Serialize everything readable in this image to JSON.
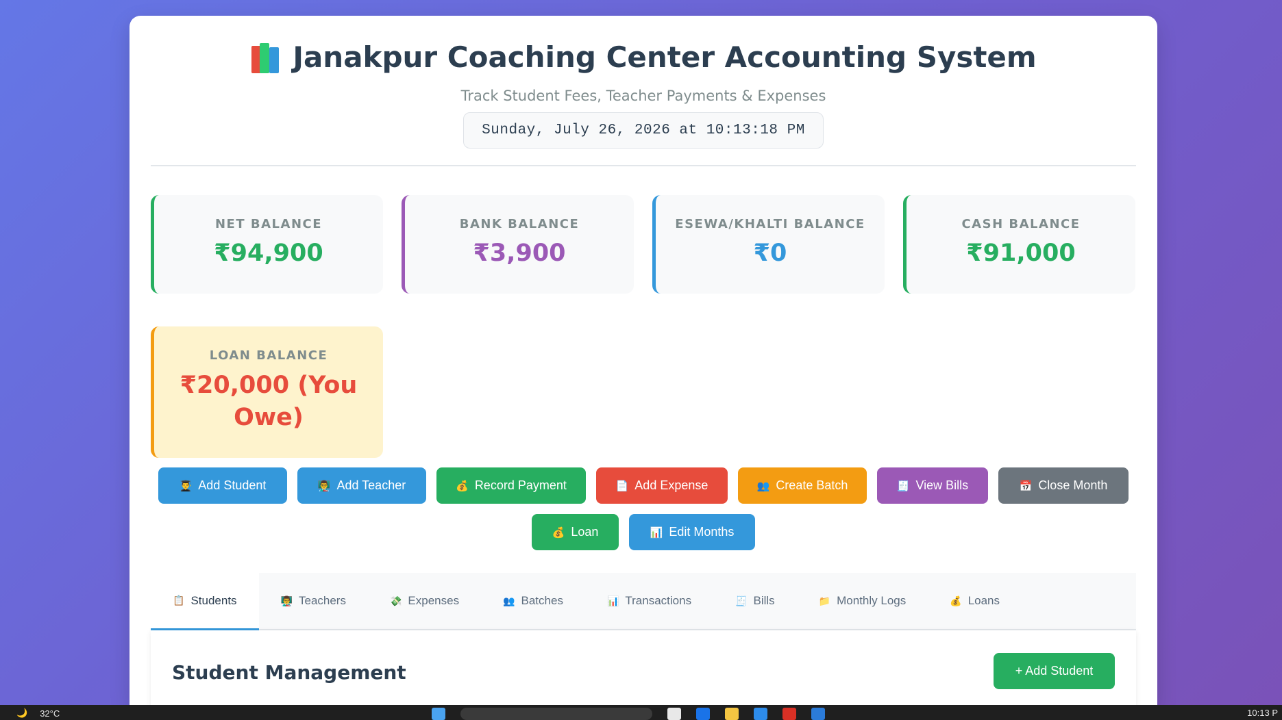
{
  "header": {
    "title": "Janakpur Coaching Center Accounting System",
    "subtitle": "Track Student Fees, Teacher Payments & Expenses",
    "datetime": "Sunday, July 26, 2026 at 10:13:18 PM"
  },
  "balances": [
    {
      "label": "NET BALANCE",
      "value": "₹94,900",
      "color": "#27ae60"
    },
    {
      "label": "BANK BALANCE",
      "value": "₹3,900",
      "color": "#9b59b6"
    },
    {
      "label": "ESEWA/KHALTI BALANCE",
      "value": "₹0",
      "color": "#3498db"
    },
    {
      "label": "CASH BALANCE",
      "value": "₹91,000",
      "color": "#27ae60"
    }
  ],
  "loan_balance": {
    "label": "LOAN BALANCE",
    "value": "₹20,000 (You Owe)",
    "color": "#e74c3c"
  },
  "actions": [
    {
      "icon": "👨‍🎓",
      "label": "Add Student"
    },
    {
      "icon": "👨‍🏫",
      "label": "Add Teacher"
    },
    {
      "icon": "💰",
      "label": "Record Payment"
    },
    {
      "icon": "📄",
      "label": "Add Expense"
    },
    {
      "icon": "👥",
      "label": "Create Batch"
    },
    {
      "icon": "🧾",
      "label": "View Bills"
    },
    {
      "icon": "📅",
      "label": "Close Month"
    },
    {
      "icon": "💰",
      "label": "Loan"
    },
    {
      "icon": "📊",
      "label": "Edit Months"
    }
  ],
  "tabs": [
    {
      "icon": "📋",
      "label": "Students"
    },
    {
      "icon": "👨‍🏫",
      "label": "Teachers"
    },
    {
      "icon": "💸",
      "label": "Expenses"
    },
    {
      "icon": "👥",
      "label": "Batches"
    },
    {
      "icon": "📊",
      "label": "Transactions"
    },
    {
      "icon": "🧾",
      "label": "Bills"
    },
    {
      "icon": "📁",
      "label": "Monthly Logs"
    },
    {
      "icon": "💰",
      "label": "Loans"
    }
  ],
  "panel": {
    "title": "Student Management",
    "add_button": "+ Add Student"
  },
  "taskbar": {
    "temperature": "32°C",
    "clock": "10:13 P"
  }
}
